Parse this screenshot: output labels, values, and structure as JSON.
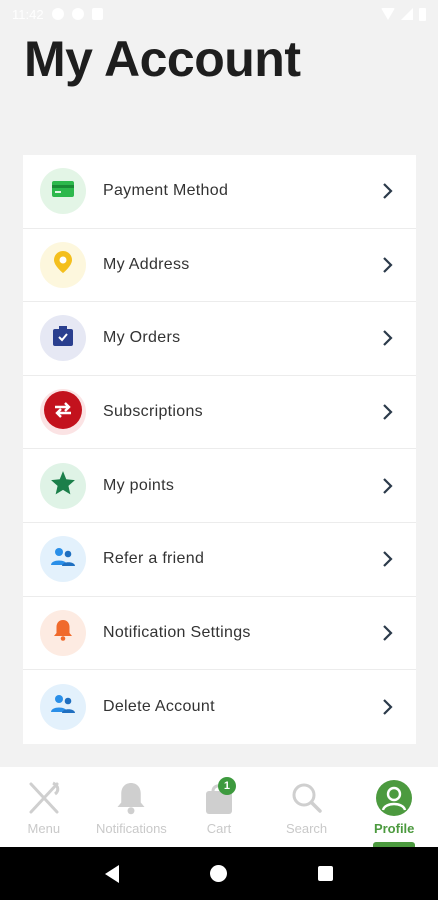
{
  "status_bar": {
    "time": "11:42"
  },
  "page": {
    "title": "My Account"
  },
  "menu": {
    "items": [
      {
        "label": "Payment Method",
        "icon": "credit-card-icon",
        "icon_color": "#2db84c",
        "bg_color": "#e3f5e6"
      },
      {
        "label": "My Address",
        "icon": "location-pin-icon",
        "icon_color": "#f4bf1d",
        "bg_color": "#fdf7dd"
      },
      {
        "label": "My Orders",
        "icon": "orders-box-icon",
        "icon_color": "#2a3f8f",
        "bg_color": "#e6e8f4"
      },
      {
        "label": "Subscriptions",
        "icon": "repeat-icon",
        "icon_color": "#b8101a",
        "bg_color": "#c3121d"
      },
      {
        "label": "My points",
        "icon": "star-icon",
        "icon_color": "#1b7f4a",
        "bg_color": "#dff3e6"
      },
      {
        "label": "Refer a friend",
        "icon": "users-icon",
        "icon_color": "#2a8fe8",
        "bg_color": "#e3f1fc"
      },
      {
        "label": "Notification Settings",
        "icon": "bell-icon",
        "icon_color": "#f06a2c",
        "bg_color": "#fdebe2"
      },
      {
        "label": "Delete Account",
        "icon": "users-icon",
        "icon_color": "#2a8fe8",
        "bg_color": "#e3f1fc"
      }
    ]
  },
  "bottom_nav": {
    "items": [
      {
        "label": "Menu",
        "icon": "fork-knife-icon"
      },
      {
        "label": "Notifications",
        "icon": "bell-icon"
      },
      {
        "label": "Cart",
        "icon": "shopping-bag-icon",
        "badge": "1"
      },
      {
        "label": "Search",
        "icon": "search-icon"
      },
      {
        "label": "Profile",
        "icon": "profile-icon",
        "active": true
      }
    ],
    "active_color": "#4c9a3f",
    "inactive_color": "#c9c9c9"
  }
}
